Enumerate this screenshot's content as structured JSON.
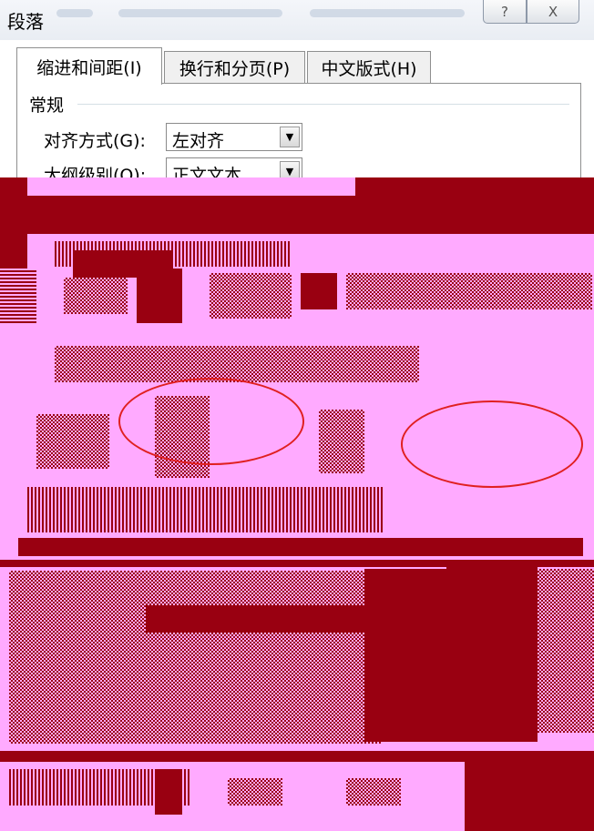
{
  "dialog": {
    "title": "段落",
    "help_button": "?",
    "close_button": "X"
  },
  "tabs": [
    {
      "label": "缩进和间距(I)",
      "active": true
    },
    {
      "label": "换行和分页(P)",
      "active": false
    },
    {
      "label": "中文版式(H)",
      "active": false
    }
  ],
  "general": {
    "section_label": "常规",
    "alignment": {
      "label": "对齐方式(G):",
      "value": "左对齐"
    },
    "outline_level": {
      "label": "大纲级别(O):",
      "value": "正文文本"
    }
  },
  "icons": {
    "dropdown": "chevron-down-icon",
    "help": "question-icon",
    "close": "close-icon"
  },
  "colors": {
    "glitch_background": "#ffaaff",
    "glitch_foreground": "#990011",
    "annotation_circle": "#e02020"
  }
}
